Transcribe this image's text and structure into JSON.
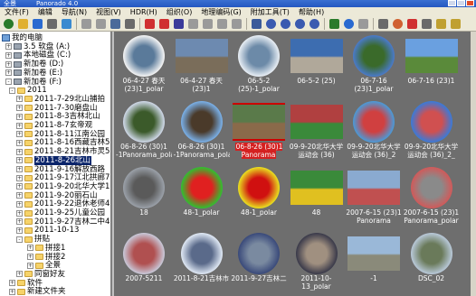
{
  "app": {
    "title": "全景 - Panorado 4.0",
    "title_short": "全景",
    "title_right": "Panorado 4.0"
  },
  "menu": [
    "文件(F)",
    "编辑",
    "导航(N)",
    "视图(V)",
    "HDR(H)",
    "组织(O)",
    "地理编码(G)",
    "附加工具(T)",
    "帮助(H)"
  ],
  "toolbar_icons": [
    "pano-icon",
    "folder-icon",
    "refresh-icon",
    "grid-icon",
    "image-icon",
    "up-icon",
    "back-icon",
    "view-icon",
    "hand-icon",
    "rotate-icon",
    "stop-icon",
    "frame-icon",
    "prev-icon",
    "pause-icon",
    "next-icon",
    "play-icon",
    "fullscreen-icon",
    "zoom-in-icon",
    "zoom-100-icon",
    "zoom-out-icon",
    "zoom-fit-icon",
    "map-icon",
    "earth-icon",
    "back-arrow-icon",
    "settings-icon",
    "globe-icon",
    "tag-icon",
    "gear-icon",
    "wrench-icon",
    "help-icon"
  ],
  "tree": [
    {
      "label": "我的电脑",
      "indent": 0,
      "icon": "pc"
    },
    {
      "label": "3.5 软盘 (A:)",
      "indent": 1,
      "icon": "dev",
      "pm": "+"
    },
    {
      "label": "本地磁盘 (C:)",
      "indent": 1,
      "icon": "dev",
      "pm": "+"
    },
    {
      "label": "新加卷 (D:)",
      "indent": 1,
      "icon": "dev",
      "pm": "+"
    },
    {
      "label": "新加卷 (E:)",
      "indent": 1,
      "icon": "dev",
      "pm": "+"
    },
    {
      "label": "新加卷 (F:)",
      "indent": 1,
      "icon": "dev",
      "pm": "-"
    },
    {
      "label": "2011",
      "indent": 2,
      "icon": "fold",
      "pm": "-"
    },
    {
      "label": "2011-7-29北山捕拍",
      "indent": 3,
      "icon": "fold",
      "pm": "+"
    },
    {
      "label": "2011-7-30磨盘山",
      "indent": 3,
      "icon": "fold",
      "pm": "+"
    },
    {
      "label": "2011-8-3吉林北山",
      "indent": 3,
      "icon": "fold",
      "pm": "+"
    },
    {
      "label": "2011-8-7玄帝观",
      "indent": 3,
      "icon": "fold",
      "pm": "+"
    },
    {
      "label": "2011-8-11江南公园",
      "indent": 3,
      "icon": "fold",
      "pm": "+"
    },
    {
      "label": "2011-8-16西藏吉林5",
      "indent": 3,
      "icon": "fold",
      "pm": "+"
    },
    {
      "label": "2011-8-21吉林市灵5",
      "indent": 3,
      "icon": "fold",
      "pm": "+"
    },
    {
      "label": "2011-8-26北山",
      "indent": 3,
      "icon": "fold",
      "pm": "+",
      "selected": true
    },
    {
      "label": "2011-9-16解放西路",
      "indent": 3,
      "icon": "fold",
      "pm": "+"
    },
    {
      "label": "2011-9-17江北拱廊7",
      "indent": 3,
      "icon": "fold",
      "pm": "+"
    },
    {
      "label": "2011-9-20北华大学1",
      "indent": 3,
      "icon": "fold",
      "pm": "+"
    },
    {
      "label": "2011-9-20丽石山",
      "indent": 3,
      "icon": "fold",
      "pm": "+"
    },
    {
      "label": "2011-9-22退休老师4",
      "indent": 3,
      "icon": "fold",
      "pm": "+"
    },
    {
      "label": "2011-9-25儿童公园",
      "indent": 3,
      "icon": "fold",
      "pm": "+"
    },
    {
      "label": "2011-9-27吉林二中4",
      "indent": 3,
      "icon": "fold",
      "pm": "+"
    },
    {
      "label": "2011-10-13",
      "indent": 3,
      "icon": "fold",
      "pm": "+"
    },
    {
      "label": "拼贴",
      "indent": 3,
      "icon": "fold",
      "pm": "-"
    },
    {
      "label": "拼接1",
      "indent": 4,
      "icon": "fold",
      "pm": "+"
    },
    {
      "label": "拼接2",
      "indent": 4,
      "icon": "fold",
      "pm": "+"
    },
    {
      "label": "全景",
      "indent": 4,
      "icon": "fold",
      "pm": "+"
    },
    {
      "label": "同窗好友",
      "indent": 3,
      "icon": "fold",
      "pm": "+"
    },
    {
      "label": "软件",
      "indent": 2,
      "icon": "fold",
      "pm": "+"
    },
    {
      "label": "新建文件夹",
      "indent": 2,
      "icon": "fold",
      "pm": "+"
    }
  ],
  "thumbs": [
    {
      "caption": "06-4-27 春天 (23)1_polar",
      "kind": "planet",
      "c1": "#f4f4f4",
      "c2": "#5a7a9a"
    },
    {
      "caption": "06-4-27 春天 (23)1",
      "kind": "photo",
      "c1": "#6d8ab0",
      "c2": "#7a6d5a"
    },
    {
      "caption": "06-5-2 (25)-1_polar",
      "kind": "planet",
      "c1": "#e8eef4",
      "c2": "#6c8aa8"
    },
    {
      "caption": "06-5-2 (25)",
      "kind": "photo",
      "c1": "#3d6db0",
      "c2": "#b0a89a"
    },
    {
      "caption": "06-7-16 (23)1_polar",
      "kind": "planet",
      "c1": "#4a7ac8",
      "c2": "#3a6a2a"
    },
    {
      "caption": "06-7-16 (23)1",
      "kind": "photo",
      "c1": "#6aa0e0",
      "c2": "#5a8a3a"
    },
    {
      "caption": "06-8-26 (30)1 -1Panorama_polar",
      "kind": "planet",
      "c1": "#cfd8e8",
      "c2": "#3b5a2a"
    },
    {
      "caption": "06-8-26 (30)1 -1Panorama_polar",
      "kind": "planet",
      "c1": "#7ab0e8",
      "c2": "#4a3a2a"
    },
    {
      "caption": "06-8-26 (30)1 Panorama",
      "kind": "photo",
      "c1": "#5a7a4a",
      "c2": "#8a6a4a",
      "selected": true
    },
    {
      "caption": "09-9-20北华大学 运动会 (36)",
      "kind": "photo",
      "c1": "#b04040",
      "c2": "#3a8a3a"
    },
    {
      "caption": "09-9-20北华大学 运动会 (36)_2",
      "kind": "planet",
      "c1": "#4a9ad8",
      "c2": "#d04040"
    },
    {
      "caption": "09-9-20北华大学 运动会 (36)_2_",
      "kind": "planet",
      "c1": "#3a7ad8",
      "c2": "#d05050"
    },
    {
      "caption": "18",
      "kind": "planet",
      "c1": "#9aa0a8",
      "c2": "#5a5a5a"
    },
    {
      "caption": "48-1_polar",
      "kind": "planet",
      "c1": "#30c030",
      "c2": "#e02020"
    },
    {
      "caption": "48-1_polar",
      "kind": "planet",
      "c1": "#e8e020",
      "c2": "#d01010"
    },
    {
      "caption": "48",
      "kind": "photo",
      "c1": "#3a8a3a",
      "c2": "#e0c020"
    },
    {
      "caption": "2007-6-15 (23)1 Panorama",
      "kind": "photo",
      "c1": "#8aaad0",
      "c2": "#c05050"
    },
    {
      "caption": "2007-6-15 (23)1 Panorama_polar",
      "kind": "planet",
      "c1": "#d05a5a",
      "c2": "#8a8a8a"
    },
    {
      "caption": "2007-5211",
      "kind": "planet",
      "c1": "#c8c8d8",
      "c2": "#b05050"
    },
    {
      "caption": "2011-8-21吉林市",
      "kind": "planet",
      "c1": "#dfe8f4",
      "c2": "#5a6a8a"
    },
    {
      "caption": "2011-9-27吉林二",
      "kind": "planet",
      "c1": "#3a4a7a",
      "c2": "#7a8aa0"
    },
    {
      "caption": "2011-10-13_polar",
      "kind": "planet",
      "c1": "#3a3a4a",
      "c2": "#a09080"
    },
    {
      "caption": "-1",
      "kind": "photo",
      "c1": "#9ab8d8",
      "c2": "#8a8a7a"
    },
    {
      "caption": "DSC_02",
      "kind": "planet",
      "c1": "#b8c8d8",
      "c2": "#6a7a5a"
    }
  ],
  "colors": {
    "tree_selection": "#0a246a",
    "grid_bg": "#6e6e6e",
    "caption_highlight": "#d42020",
    "selected_frame": "#cc0000"
  }
}
